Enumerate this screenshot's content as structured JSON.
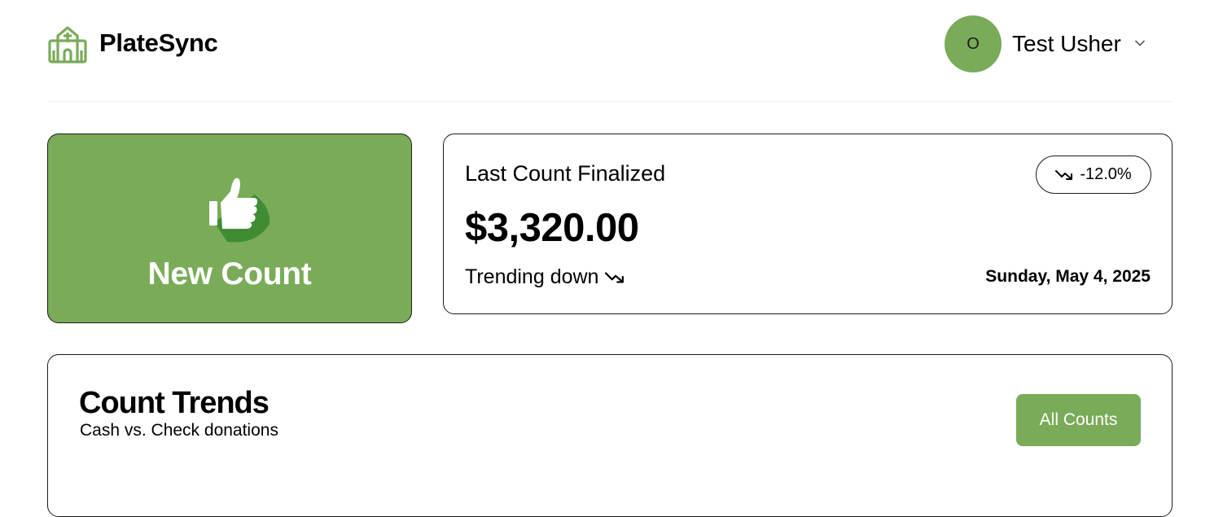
{
  "app": {
    "name": "PlateSync",
    "logo_icon": "church-icon"
  },
  "user": {
    "avatar_initial": "O",
    "name": "Test Usher",
    "menu_icon": "chevron-down-icon"
  },
  "new_count": {
    "label": "New Count",
    "icon": "thumbs-up-icon"
  },
  "last_count": {
    "title": "Last Count Finalized",
    "amount": "$3,320.00",
    "change": "-12.0%",
    "trend_text": "Trending down",
    "trend_icon": "trending-down-icon",
    "date": "Sunday, May 4, 2025"
  },
  "trends": {
    "title": "Count Trends",
    "subtitle": "Cash vs. Check donations",
    "button_label": "All Counts"
  },
  "colors": {
    "brand_green": "#7aab58",
    "dark_green": "#3f8c35",
    "border": "#1c1c1c"
  }
}
